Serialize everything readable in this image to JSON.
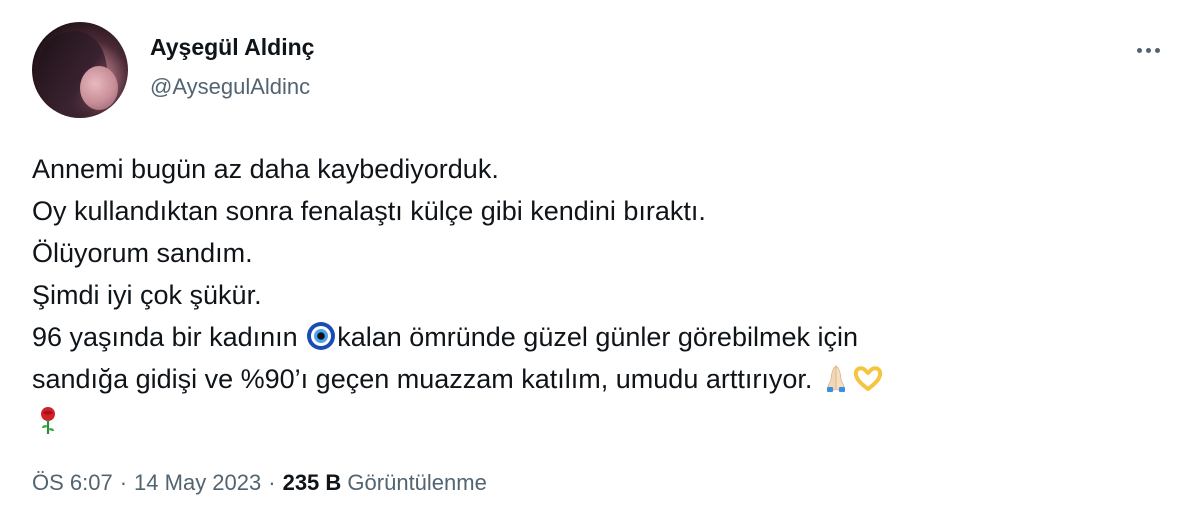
{
  "author": {
    "display_name": "Ayşegül Aldinç",
    "handle": "@AysegulAldinc",
    "avatar_icon": "profile-photo"
  },
  "more_icon": "more-horizontal-icon",
  "tweet": {
    "line1": "Annemi bugün az daha kaybediyorduk.",
    "line2": "Oy kullandıktan sonra fenalaştı külçe gibi kendini bıraktı.",
    "line3": "Ölüyorum sandım.",
    "line4": "Şimdi iyi çok şükür.",
    "line5_before_emoji": "96 yaşında bir kadının ",
    "line5_after_emoji": "kalan ömründe güzel günler görebilmek için",
    "line6": "sandığa gidişi ve %90’ı geçen muazzam katılım, umudu arttırıyor. ",
    "emojis": [
      "nazar-amulet-icon",
      "folded-hands-icon",
      "heart-hands-icon",
      "rose-icon"
    ]
  },
  "meta": {
    "time": "ÖS 6:07",
    "separator": "·",
    "date": "14 May 2023",
    "views_count": "235 B",
    "views_label": "Görüntülenme"
  },
  "colors": {
    "text_primary": "#0f1419",
    "text_secondary": "#536471",
    "background": "#ffffff"
  }
}
